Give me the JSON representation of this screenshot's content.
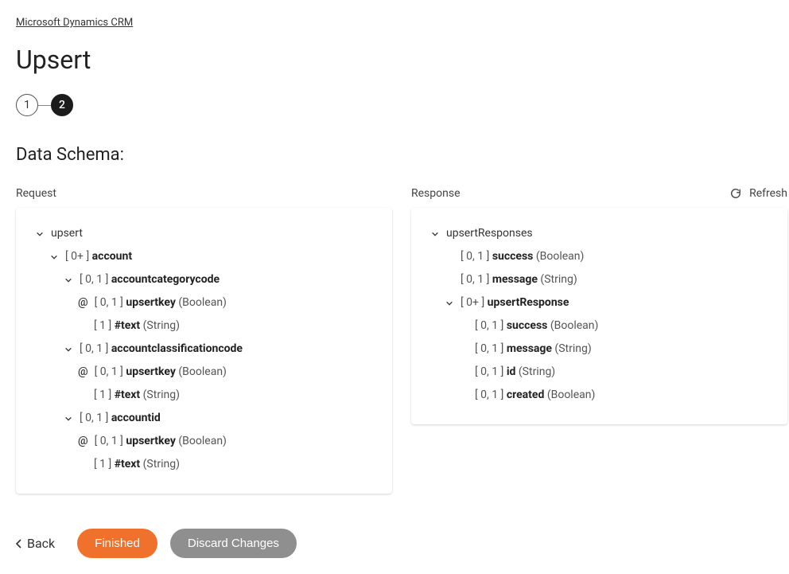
{
  "breadcrumb": "Microsoft Dynamics CRM",
  "page_title": "Upsert",
  "steps": [
    "1",
    "2"
  ],
  "section_title": "Data Schema:",
  "refresh_label": "Refresh",
  "columns": {
    "request_label": "Request",
    "response_label": "Response"
  },
  "request_tree": [
    {
      "indent": 0,
      "expand": true,
      "card": "",
      "name": "upsert",
      "type": "",
      "bold": false
    },
    {
      "indent": 1,
      "expand": true,
      "card": "[ 0+ ] ",
      "name": "account",
      "type": "",
      "bold": true
    },
    {
      "indent": 2,
      "expand": true,
      "card": "[ 0, 1 ] ",
      "name": "accountcategorycode",
      "type": "",
      "bold": true
    },
    {
      "indent": 3,
      "at": true,
      "card": "[ 0, 1 ] ",
      "name": "upsertkey",
      "type": " (Boolean)",
      "bold": true
    },
    {
      "indent": 3,
      "card": "[ 1 ] ",
      "name": "#text",
      "type": " (String)",
      "bold": true
    },
    {
      "indent": 2,
      "expand": true,
      "card": "[ 0, 1 ] ",
      "name": "accountclassificationcode",
      "type": "",
      "bold": true
    },
    {
      "indent": 3,
      "at": true,
      "card": "[ 0, 1 ] ",
      "name": "upsertkey",
      "type": " (Boolean)",
      "bold": true
    },
    {
      "indent": 3,
      "card": "[ 1 ] ",
      "name": "#text",
      "type": " (String)",
      "bold": true
    },
    {
      "indent": 2,
      "expand": true,
      "card": "[ 0, 1 ] ",
      "name": "accountid",
      "type": "",
      "bold": true
    },
    {
      "indent": 3,
      "at": true,
      "card": "[ 0, 1 ] ",
      "name": "upsertkey",
      "type": " (Boolean)",
      "bold": true
    },
    {
      "indent": 3,
      "card": "[ 1 ] ",
      "name": "#text",
      "type": " (String)",
      "bold": true
    }
  ],
  "response_tree": [
    {
      "indent": 0,
      "expand": true,
      "card": "",
      "name": "upsertResponses",
      "type": "",
      "bold": false
    },
    {
      "indent": 1,
      "card": "[ 0, 1 ] ",
      "name": "success",
      "type": " (Boolean)",
      "bold": true
    },
    {
      "indent": 1,
      "card": "[ 0, 1 ] ",
      "name": "message",
      "type": " (String)",
      "bold": true
    },
    {
      "indent": 1,
      "expand": true,
      "card": "[ 0+ ] ",
      "name": "upsertResponse",
      "type": "",
      "bold": true
    },
    {
      "indent": 2,
      "card": "[ 0, 1 ] ",
      "name": "success",
      "type": " (Boolean)",
      "bold": true
    },
    {
      "indent": 2,
      "card": "[ 0, 1 ] ",
      "name": "message",
      "type": " (String)",
      "bold": true
    },
    {
      "indent": 2,
      "card": "[ 0, 1 ] ",
      "name": "id",
      "type": " (String)",
      "bold": true
    },
    {
      "indent": 2,
      "card": "[ 0, 1 ] ",
      "name": "created",
      "type": " (Boolean)",
      "bold": true
    }
  ],
  "footer": {
    "back": "Back",
    "finished": "Finished",
    "discard": "Discard Changes"
  }
}
